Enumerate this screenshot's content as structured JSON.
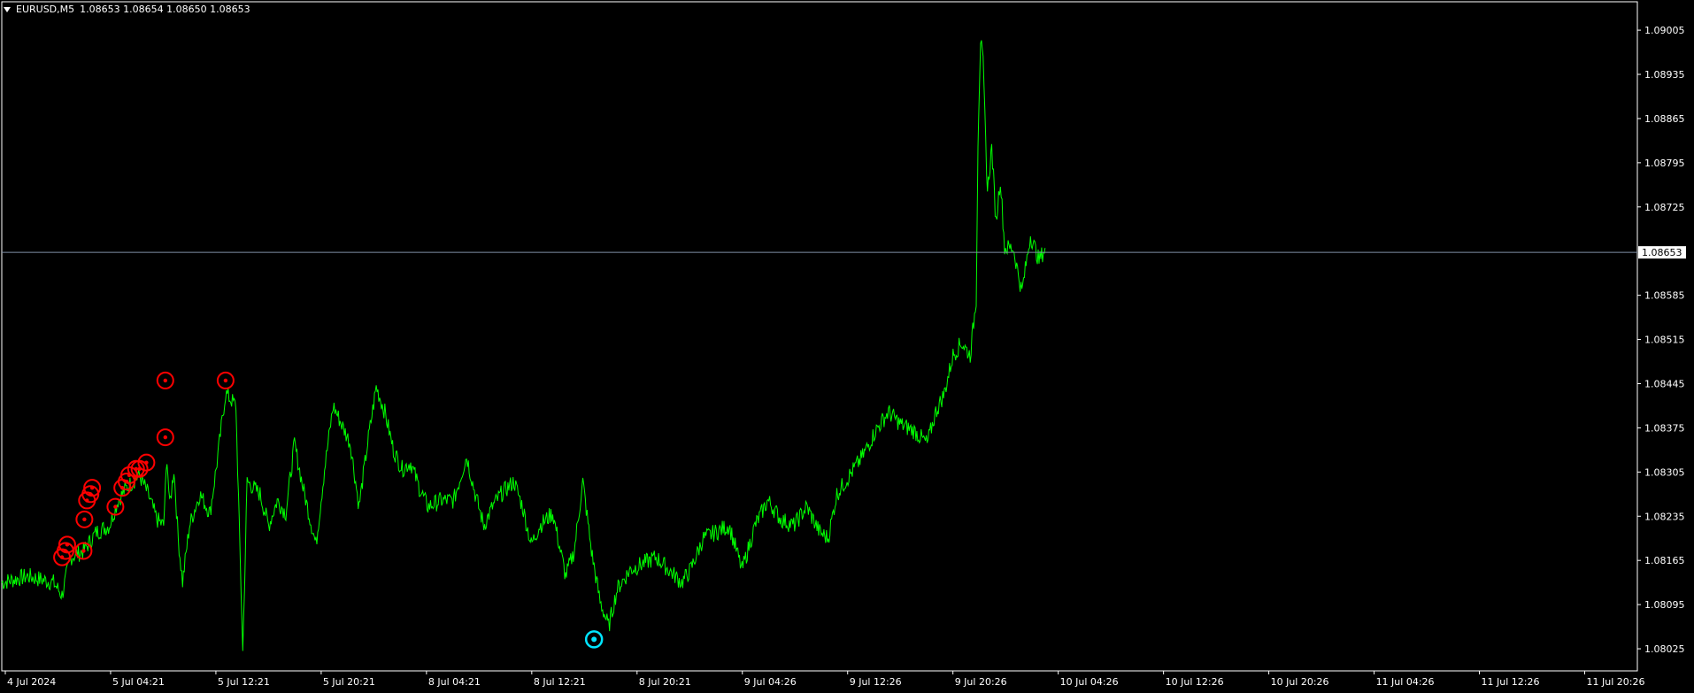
{
  "header": {
    "symbol_timeframe": "EURUSD,M5",
    "ohlc": "1.08653 1.08654 1.08650 1.08653"
  },
  "colors": {
    "background": "#000000",
    "price_line": "#00ff00",
    "axis": "#ffffff",
    "current_price_line": "#7f8fa6",
    "sell_marker": "#ff0000",
    "buy_marker": "#00e5ff"
  },
  "current_price": {
    "value": 1.08653,
    "label": "1.08653"
  },
  "chart_data": {
    "type": "line",
    "title": "EURUSD,M5",
    "ylim": [
      1.0799,
      1.0905
    ],
    "y_ticks": [
      "1.09005",
      "1.08935",
      "1.08865",
      "1.08795",
      "1.08725",
      "1.08585",
      "1.08515",
      "1.08445",
      "1.08375",
      "1.08305",
      "1.08235",
      "1.08165",
      "1.08095",
      "1.08025"
    ],
    "x_ticks": [
      "4 Jul 2024",
      "5 Jul 04:21",
      "5 Jul 12:21",
      "5 Jul 20:21",
      "8 Jul 04:21",
      "8 Jul 12:21",
      "8 Jul 20:21",
      "9 Jul 04:26",
      "9 Jul 12:26",
      "9 Jul 20:26",
      "10 Jul 04:26",
      "10 Jul 12:26",
      "10 Jul 20:26",
      "11 Jul 04:26",
      "11 Jul 12:26",
      "11 Jul 20:26"
    ],
    "x_index_range": [
      0,
      1900
    ],
    "series": [
      {
        "values_xy": [
          [
            0,
            1.0813
          ],
          [
            30,
            1.0814
          ],
          [
            60,
            1.0813
          ],
          [
            70,
            1.0811
          ],
          [
            80,
            1.0817
          ],
          [
            95,
            1.0818
          ],
          [
            110,
            1.0821
          ],
          [
            125,
            1.0822
          ],
          [
            135,
            1.0826
          ],
          [
            145,
            1.0828
          ],
          [
            160,
            1.083
          ],
          [
            170,
            1.0827
          ],
          [
            180,
            1.0823
          ],
          [
            188,
            1.0822
          ],
          [
            192,
            1.0833
          ],
          [
            195,
            1.0825
          ],
          [
            200,
            1.0831
          ],
          [
            205,
            1.082
          ],
          [
            210,
            1.0813
          ],
          [
            218,
            1.0822
          ],
          [
            230,
            1.0827
          ],
          [
            242,
            1.0824
          ],
          [
            250,
            1.0832
          ],
          [
            260,
            1.0843
          ],
          [
            272,
            1.0841
          ],
          [
            280,
            1.0802
          ],
          [
            285,
            1.0829
          ],
          [
            300,
            1.0827
          ],
          [
            310,
            1.0822
          ],
          [
            320,
            1.0826
          ],
          [
            330,
            1.0824
          ],
          [
            340,
            1.0835
          ],
          [
            350,
            1.0828
          ],
          [
            365,
            1.0819
          ],
          [
            375,
            1.0831
          ],
          [
            385,
            1.0841
          ],
          [
            395,
            1.0838
          ],
          [
            405,
            1.0835
          ],
          [
            415,
            1.0825
          ],
          [
            425,
            1.0835
          ],
          [
            435,
            1.0844
          ],
          [
            445,
            1.084
          ],
          [
            455,
            1.0834
          ],
          [
            465,
            1.0831
          ],
          [
            475,
            1.0832
          ],
          [
            485,
            1.0828
          ],
          [
            495,
            1.0825
          ],
          [
            510,
            1.0826
          ],
          [
            525,
            1.0826
          ],
          [
            540,
            1.0833
          ],
          [
            550,
            1.0827
          ],
          [
            560,
            1.0822
          ],
          [
            570,
            1.0825
          ],
          [
            580,
            1.0827
          ],
          [
            595,
            1.0829
          ],
          [
            605,
            1.0825
          ],
          [
            615,
            1.0819
          ],
          [
            625,
            1.0822
          ],
          [
            640,
            1.0824
          ],
          [
            655,
            1.0814
          ],
          [
            665,
            1.0818
          ],
          [
            675,
            1.0829
          ],
          [
            685,
            1.0818
          ],
          [
            695,
            1.081
          ],
          [
            705,
            1.0806
          ],
          [
            715,
            1.0812
          ],
          [
            730,
            1.0815
          ],
          [
            745,
            1.0816
          ],
          [
            760,
            1.0817
          ],
          [
            775,
            1.0815
          ],
          [
            790,
            1.0813
          ],
          [
            800,
            1.0815
          ],
          [
            815,
            1.082
          ],
          [
            830,
            1.0821
          ],
          [
            845,
            1.0822
          ],
          [
            860,
            1.0815
          ],
          [
            875,
            1.0822
          ],
          [
            890,
            1.0826
          ],
          [
            905,
            1.0823
          ],
          [
            920,
            1.0822
          ],
          [
            935,
            1.0825
          ],
          [
            950,
            1.0821
          ],
          [
            960,
            1.082
          ],
          [
            970,
            1.0827
          ],
          [
            985,
            1.083
          ],
          [
            1000,
            1.0833
          ],
          [
            1015,
            1.0837
          ],
          [
            1030,
            1.084
          ],
          [
            1045,
            1.0838
          ],
          [
            1060,
            1.0837
          ],
          [
            1075,
            1.0835
          ],
          [
            1085,
            1.084
          ],
          [
            1095,
            1.0843
          ],
          [
            1105,
            1.0849
          ],
          [
            1115,
            1.0851
          ],
          [
            1125,
            1.0849
          ],
          [
            1132,
            1.0858
          ],
          [
            1134,
            1.0883
          ],
          [
            1137,
            1.0899
          ],
          [
            1140,
            1.0895
          ],
          [
            1145,
            1.0875
          ],
          [
            1150,
            1.0882
          ],
          [
            1155,
            1.087
          ],
          [
            1160,
            1.0877
          ],
          [
            1165,
            1.0866
          ],
          [
            1175,
            1.0866
          ],
          [
            1185,
            1.0859
          ],
          [
            1195,
            1.0868
          ],
          [
            1205,
            1.0864
          ],
          [
            1212,
            1.0866
          ]
        ]
      }
    ]
  },
  "markers": {
    "sell": [
      [
        70,
        1.0817
      ],
      [
        74,
        1.0818
      ],
      [
        76,
        1.0819
      ],
      [
        95,
        1.0818
      ],
      [
        96,
        1.0823
      ],
      [
        99,
        1.0826
      ],
      [
        103,
        1.0827
      ],
      [
        105,
        1.0828
      ],
      [
        132,
        1.0825
      ],
      [
        140,
        1.0828
      ],
      [
        145,
        1.0829
      ],
      [
        148,
        1.083
      ],
      [
        156,
        1.0831
      ],
      [
        160,
        1.0831
      ],
      [
        168,
        1.0832
      ],
      [
        190,
        1.0836
      ],
      [
        190,
        1.0845
      ],
      [
        260,
        1.0845
      ]
    ],
    "buy": [
      [
        688,
        1.0804
      ]
    ]
  }
}
